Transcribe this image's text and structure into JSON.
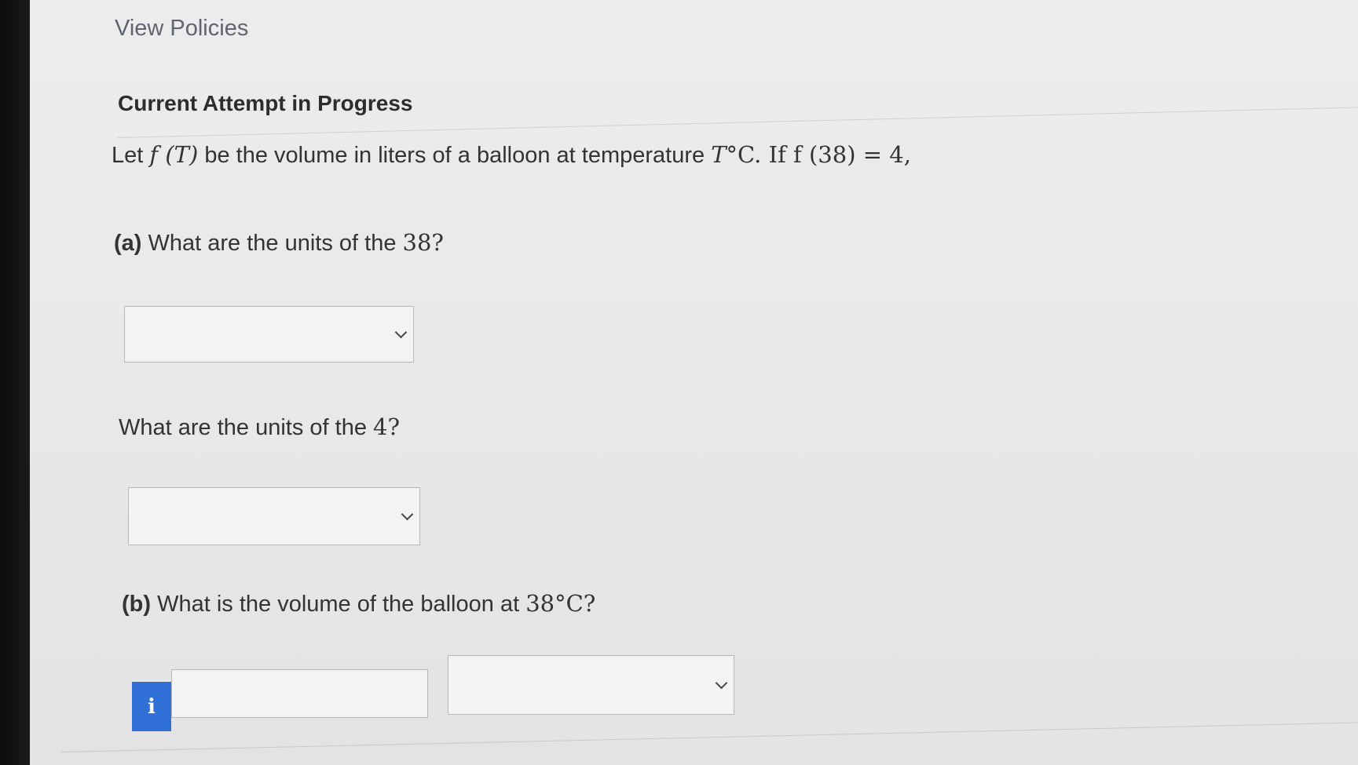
{
  "header": {
    "view_policies_label": "View Policies",
    "section_title": "Current Attempt in Progress"
  },
  "question": {
    "intro_prefix": "Let ",
    "intro_func": "f (T)",
    "intro_mid": " be the volume in liters of a balloon at temperature ",
    "intro_temp": "T",
    "intro_deg": "°C. If ",
    "intro_eq": "f (38) = 4,",
    "part_a_label": "(a)",
    "part_a_text": " What are the units of the ",
    "part_a_num": "38?",
    "part_a2_text": "What are the units of the ",
    "part_a2_num": "4?",
    "part_b_label": "(b)",
    "part_b_text": " What is the volume of the balloon at ",
    "part_b_temp": "38°C?"
  },
  "inputs": {
    "units_38_select": {
      "value": ""
    },
    "units_4_select": {
      "value": ""
    },
    "volume_input": {
      "value": ""
    },
    "volume_units_select": {
      "value": ""
    },
    "info_icon_glyph": "i"
  },
  "colors": {
    "info_button": "#2f6fd6",
    "link": "#5f6470",
    "text": "#333333"
  }
}
